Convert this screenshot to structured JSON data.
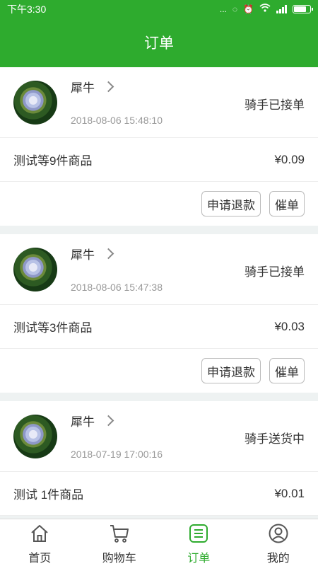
{
  "status_bar": {
    "time": "下午3:30",
    "dots": "..."
  },
  "header": {
    "title": "订单"
  },
  "orders": [
    {
      "shop": "犀牛",
      "time": "2018-08-06 15:48:10",
      "status": "骑手已接单",
      "goods": "测试等9件商品",
      "price": "¥0.09",
      "actions": [
        "申请退款",
        "催单"
      ]
    },
    {
      "shop": "犀牛",
      "time": "2018-08-06 15:47:38",
      "status": "骑手已接单",
      "goods": "测试等3件商品",
      "price": "¥0.03",
      "actions": [
        "申请退款",
        "催单"
      ]
    },
    {
      "shop": "犀牛",
      "time": "2018-07-19 17:00:16",
      "status": "骑手送货中",
      "goods": "测试 1件商品",
      "price": "¥0.01"
    }
  ],
  "tabbar": {
    "items": [
      {
        "label": "首页",
        "icon": "home-icon"
      },
      {
        "label": "购物车",
        "icon": "cart-icon"
      },
      {
        "label": "订单",
        "icon": "order-list-icon",
        "active": true
      },
      {
        "label": "我的",
        "icon": "profile-icon"
      }
    ]
  },
  "colors": {
    "brand": "#2eab2e",
    "background": "#eef2f2"
  }
}
